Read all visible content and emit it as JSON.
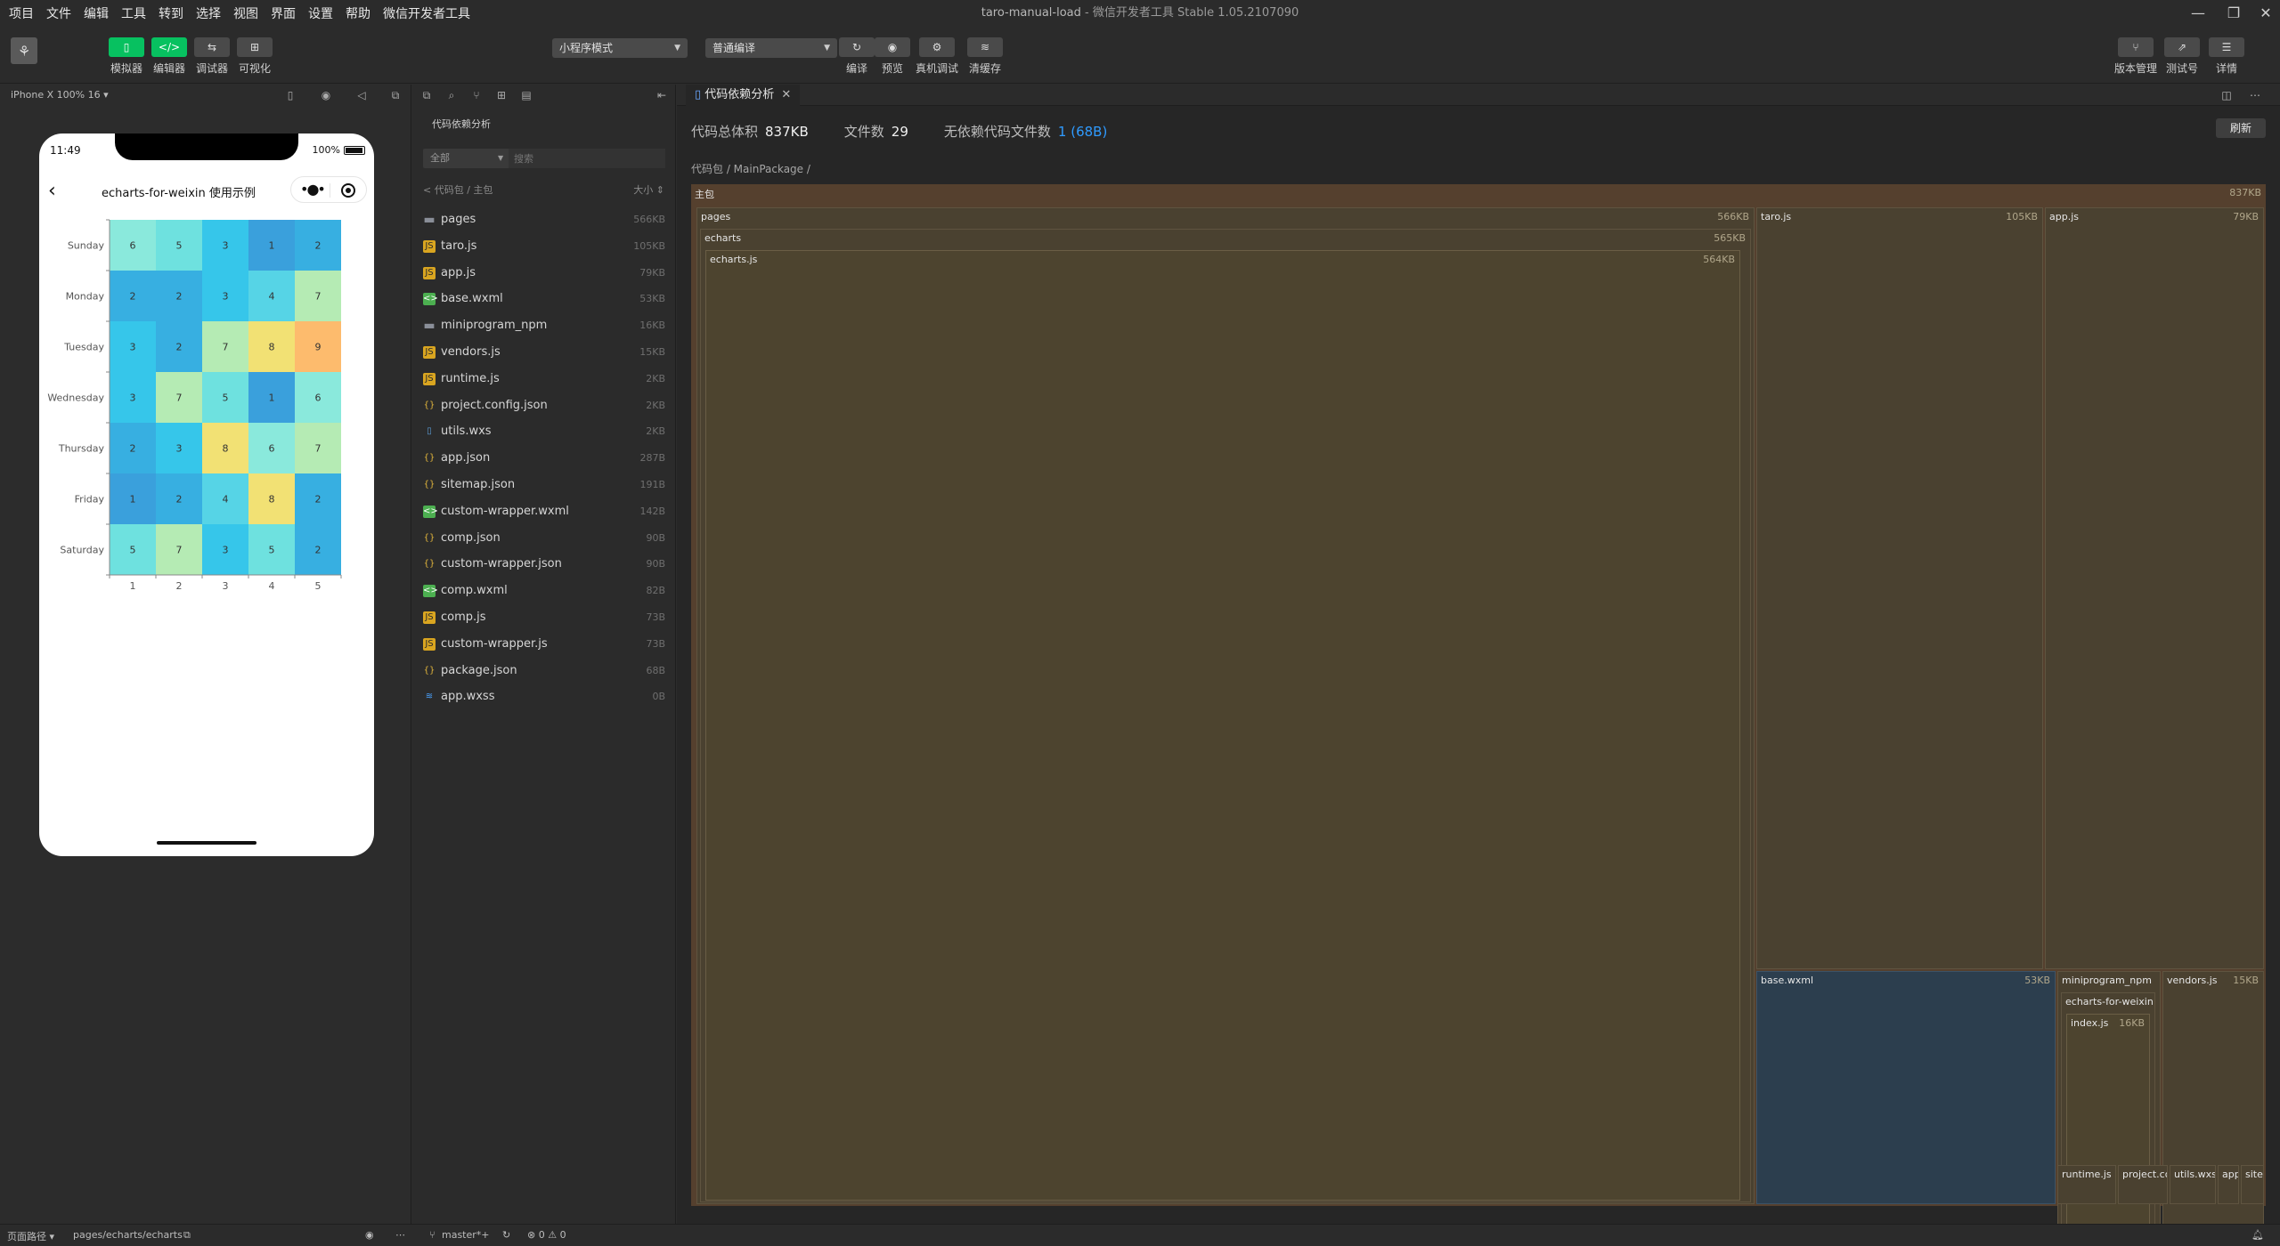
{
  "menu": [
    "项目",
    "文件",
    "编辑",
    "工具",
    "转到",
    "选择",
    "视图",
    "界面",
    "设置",
    "帮助",
    "微信开发者工具"
  ],
  "window": {
    "title": "taro-manual-load",
    "subtitle": "- 微信开发者工具 Stable 1.05.2107090",
    "min": "—",
    "max": "❐",
    "close": "✕"
  },
  "toolbar": {
    "left": [
      {
        "label": "模拟器",
        "glyph": "▯"
      },
      {
        "label": "编辑器",
        "glyph": "</>"
      },
      {
        "label": "调试器",
        "glyph": "⇆"
      },
      {
        "label": "可视化",
        "glyph": "⊞"
      }
    ],
    "mode": "小程序模式",
    "compile_mode": "普通编译",
    "center": [
      {
        "label": "编译",
        "glyph": "↻"
      },
      {
        "label": "预览",
        "glyph": "◉"
      },
      {
        "label": "真机调试",
        "glyph": "⚙"
      },
      {
        "label": "清缓存",
        "glyph": "≋"
      }
    ],
    "right": [
      {
        "label": "版本管理",
        "glyph": "⑂"
      },
      {
        "label": "测试号",
        "glyph": "⇗"
      },
      {
        "label": "详情",
        "glyph": "☰"
      }
    ]
  },
  "simulator": {
    "device": "iPhone X 100% 16 ▾",
    "time": "11:49",
    "battery": "100%",
    "page_title": "echarts-for-weixin 使用示例",
    "back": "‹",
    "capsule_dots": "•●•"
  },
  "chart_data": {
    "type": "heatmap",
    "categories": [
      "Sunday",
      "Monday",
      "Tuesday",
      "Wednesday",
      "Thursday",
      "Friday",
      "Saturday"
    ],
    "x": [
      "1",
      "2",
      "3",
      "4",
      "5"
    ],
    "values": [
      [
        6,
        5,
        3,
        1,
        2
      ],
      [
        2,
        2,
        3,
        4,
        7
      ],
      [
        3,
        2,
        7,
        8,
        9
      ],
      [
        3,
        7,
        5,
        1,
        6
      ],
      [
        2,
        3,
        8,
        6,
        7
      ],
      [
        1,
        2,
        4,
        8,
        2
      ],
      [
        5,
        7,
        3,
        5,
        2
      ]
    ],
    "palette": {
      "1": "#3aa0dc",
      "2": "#37afe1",
      "3": "#36c6ea",
      "4": "#56d4e6",
      "5": "#6ee1df",
      "6": "#8ae9dc",
      "7": "#b5ebb4",
      "8": "#f2e174",
      "9": "#fdbb6d"
    },
    "title": "",
    "xlabel": "",
    "ylabel": ""
  },
  "files": {
    "title": "代码依赖分析",
    "filter": "全部",
    "search_placeholder": "搜索",
    "crumb": "< 代码包 / 主包",
    "sort": "大小 ⇕",
    "items": [
      {
        "name": "pages",
        "size": "566KB",
        "kind": "folder"
      },
      {
        "name": "taro.js",
        "size": "105KB",
        "kind": "js"
      },
      {
        "name": "app.js",
        "size": "79KB",
        "kind": "js"
      },
      {
        "name": "base.wxml",
        "size": "53KB",
        "kind": "wxml"
      },
      {
        "name": "miniprogram_npm",
        "size": "16KB",
        "kind": "folder"
      },
      {
        "name": "vendors.js",
        "size": "15KB",
        "kind": "js"
      },
      {
        "name": "runtime.js",
        "size": "2KB",
        "kind": "js"
      },
      {
        "name": "project.config.json",
        "size": "2KB",
        "kind": "json"
      },
      {
        "name": "utils.wxs",
        "size": "2KB",
        "kind": "wxs"
      },
      {
        "name": "app.json",
        "size": "287B",
        "kind": "json"
      },
      {
        "name": "sitemap.json",
        "size": "191B",
        "kind": "json"
      },
      {
        "name": "custom-wrapper.wxml",
        "size": "142B",
        "kind": "wxml"
      },
      {
        "name": "comp.json",
        "size": "90B",
        "kind": "json"
      },
      {
        "name": "custom-wrapper.json",
        "size": "90B",
        "kind": "json"
      },
      {
        "name": "comp.wxml",
        "size": "82B",
        "kind": "wxml"
      },
      {
        "name": "comp.js",
        "size": "73B",
        "kind": "js"
      },
      {
        "name": "custom-wrapper.js",
        "size": "73B",
        "kind": "js"
      },
      {
        "name": "package.json",
        "size": "68B",
        "kind": "json"
      },
      {
        "name": "app.wxss",
        "size": "0B",
        "kind": "wxss"
      }
    ]
  },
  "editor": {
    "tab": "代码依赖分析",
    "tab_close": "✕",
    "stats": [
      {
        "label": "代码总体积",
        "value": "837KB"
      },
      {
        "label": "文件数",
        "value": "29"
      },
      {
        "label": "无依赖代码文件数",
        "value": "1 (68B)"
      }
    ],
    "refresh": "刷新",
    "path": "代码包 / MainPackage /",
    "treemap": {
      "main": {
        "label": "主包",
        "size": "837KB"
      },
      "pages": {
        "label": "pages",
        "size": "566KB"
      },
      "echarts": {
        "label": "echarts",
        "size": "565KB"
      },
      "echarts_js": {
        "label": "echarts.js",
        "size": "564KB"
      },
      "taro": {
        "label": "taro.js",
        "size": "105KB"
      },
      "app": {
        "label": "app.js",
        "size": "79KB"
      },
      "base": {
        "label": "base.wxml",
        "size": "53KB"
      },
      "npm": {
        "label": "miniprogram_npm",
        "size": "16KB"
      },
      "ecw": {
        "label": "echarts-for-weixin"
      },
      "index": {
        "label": "index.js",
        "size": "16KB"
      },
      "vendors": {
        "label": "vendors.js",
        "size": "15KB"
      },
      "runtime": {
        "label": "runtime.js",
        "size": "2KB"
      },
      "project": {
        "label": "project.config.json"
      },
      "utils": {
        "label": "utils.wxs"
      },
      "ap": {
        "label": "app.json"
      },
      "si": {
        "label": "sitemap.json"
      }
    }
  },
  "status": {
    "route_label": "页面路径 ▾",
    "route": "pages/echarts/echarts",
    "branch": "master*+",
    "errors": "⊗ 0 ⚠ 0"
  }
}
